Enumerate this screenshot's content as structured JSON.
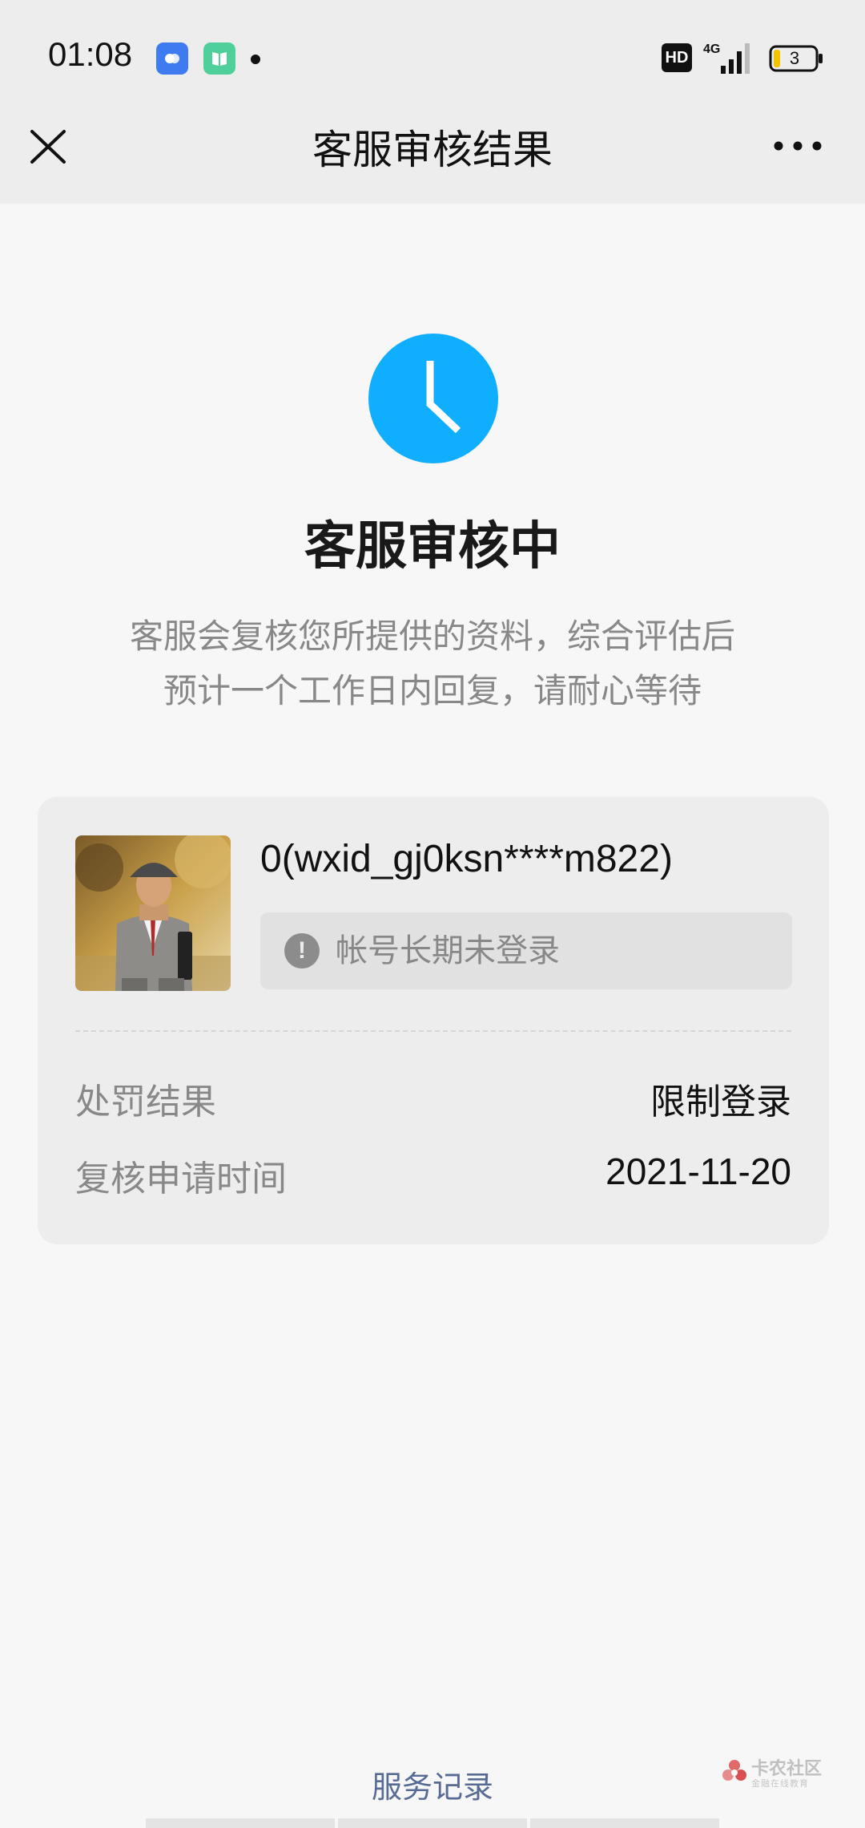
{
  "status_bar": {
    "time": "01:08",
    "hd_label": "HD",
    "network": "4G",
    "battery_level": "3"
  },
  "title_bar": {
    "title": "客服审核结果"
  },
  "status": {
    "heading": "客服审核中",
    "description_line1": "客服会复核您所提供的资料，综合评估后",
    "description_line2": "预计一个工作日内回复，请耐心等待"
  },
  "card": {
    "account_name": "0(wxid_gj0ksn****m822)",
    "reason": "帐号长期未登录",
    "rows": [
      {
        "label": "处罚结果",
        "value": "限制登录"
      },
      {
        "label": "复核申请时间",
        "value": "2021-11-20"
      }
    ]
  },
  "footer": {
    "service_record_link": "服务记录",
    "watermark_title": "卡农社区",
    "watermark_subtitle": "金融在线教育"
  },
  "colors": {
    "accent_blue": "#10aeff",
    "link_blue": "#576b95",
    "background": "#f7f7f7",
    "card": "#ededed"
  }
}
